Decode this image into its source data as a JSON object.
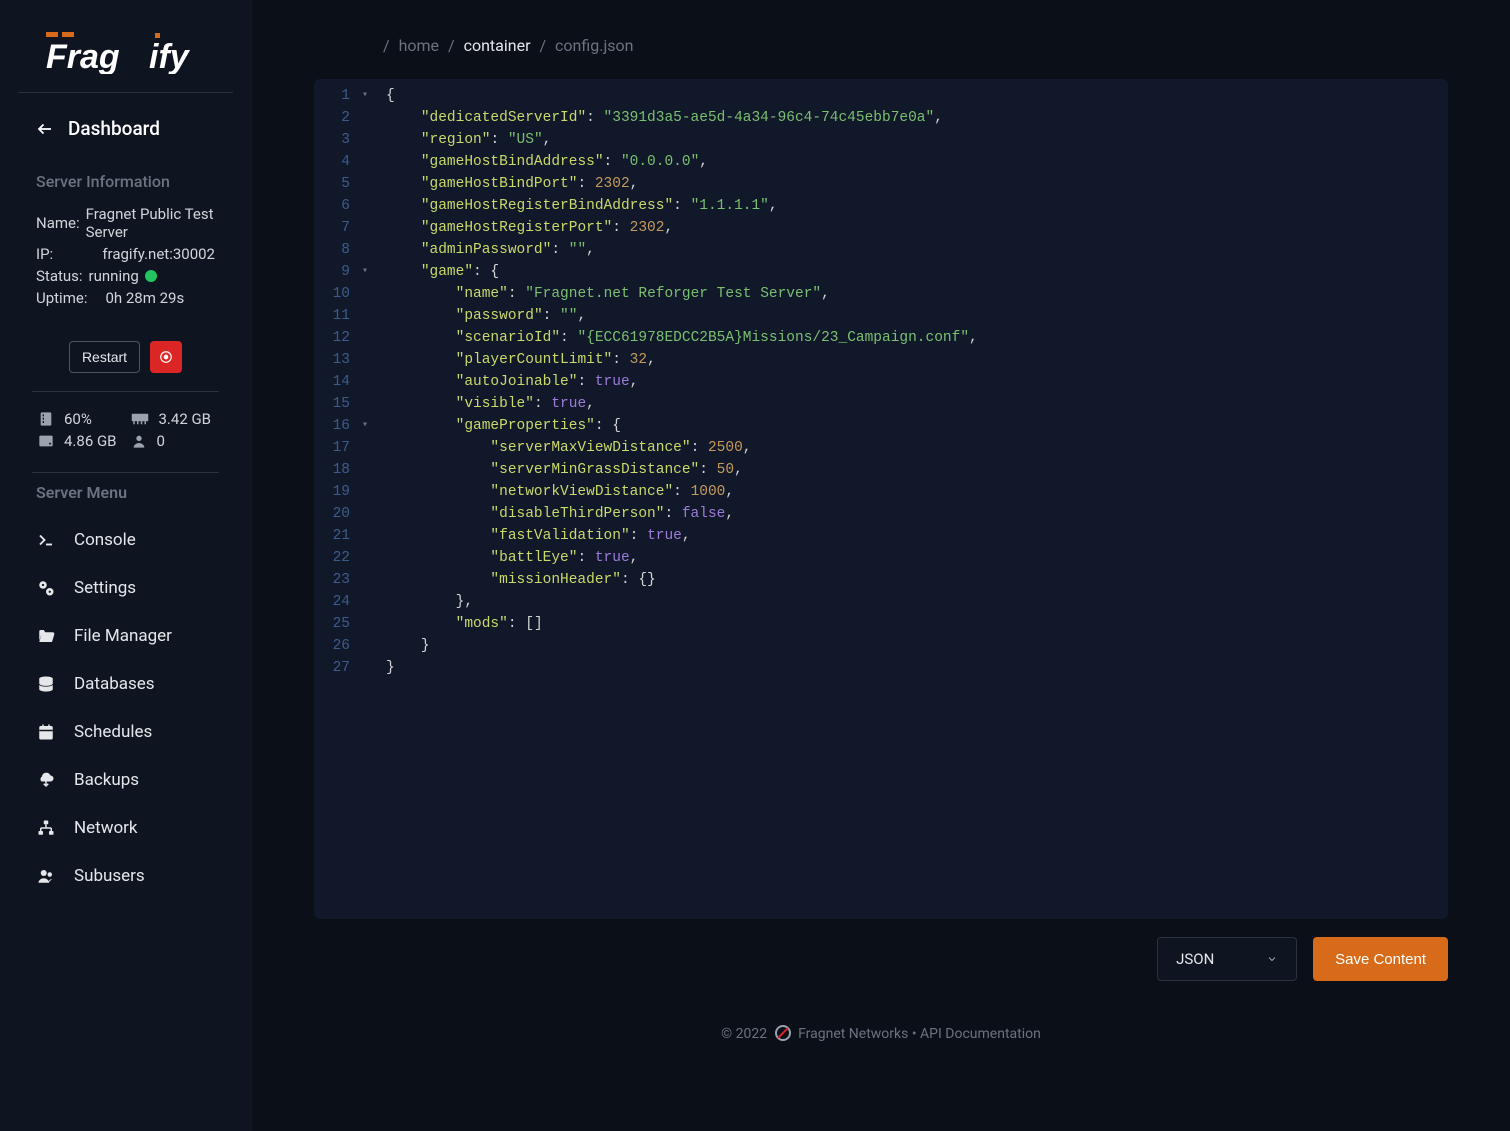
{
  "brand": "Fragify",
  "dashboard_label": "Dashboard",
  "section_info_heading": "Server Information",
  "info": {
    "name_label": "Name:",
    "name_value": "Fragnet Public Test Server",
    "ip_label": "IP:",
    "ip_value": "fragify.net:30002",
    "status_label": "Status:",
    "status_value": "running",
    "uptime_label": "Uptime:",
    "uptime_value": "0h 28m 29s"
  },
  "buttons": {
    "restart": "Restart",
    "save_content": "Save Content"
  },
  "stats": {
    "cpu_pct": "60%",
    "ram": "3.42 GB",
    "disk": "4.86 GB",
    "users": "0"
  },
  "menu_heading": "Server Menu",
  "menu": {
    "console": "Console",
    "settings": "Settings",
    "file_manager": "File Manager",
    "databases": "Databases",
    "schedules": "Schedules",
    "backups": "Backups",
    "network": "Network",
    "subusers": "Subusers"
  },
  "breadcrumb": {
    "home": "home",
    "container": "container",
    "file": "config.json"
  },
  "format_select": "JSON",
  "footer": {
    "copyright": "© 2022",
    "company": "Fragnet Networks",
    "docs": "API Documentation"
  },
  "code_lines": [
    {
      "n": 1,
      "fold": "▾",
      "indent": 0,
      "tokens": [
        {
          "t": "punc",
          "v": "{"
        }
      ]
    },
    {
      "n": 2,
      "indent": 1,
      "tokens": [
        {
          "t": "key",
          "v": "\"dedicatedServerId\""
        },
        {
          "t": "punc",
          "v": ": "
        },
        {
          "t": "str",
          "v": "\"3391d3a5-ae5d-4a34-96c4-74c45ebb7e0a\""
        },
        {
          "t": "punc",
          "v": ","
        }
      ]
    },
    {
      "n": 3,
      "indent": 1,
      "tokens": [
        {
          "t": "key",
          "v": "\"region\""
        },
        {
          "t": "punc",
          "v": ": "
        },
        {
          "t": "str",
          "v": "\"US\""
        },
        {
          "t": "punc",
          "v": ","
        }
      ]
    },
    {
      "n": 4,
      "indent": 1,
      "tokens": [
        {
          "t": "key",
          "v": "\"gameHostBindAddress\""
        },
        {
          "t": "punc",
          "v": ": "
        },
        {
          "t": "str",
          "v": "\"0.0.0.0\""
        },
        {
          "t": "punc",
          "v": ","
        }
      ]
    },
    {
      "n": 5,
      "indent": 1,
      "tokens": [
        {
          "t": "key",
          "v": "\"gameHostBindPort\""
        },
        {
          "t": "punc",
          "v": ": "
        },
        {
          "t": "num",
          "v": "2302"
        },
        {
          "t": "punc",
          "v": ","
        }
      ]
    },
    {
      "n": 6,
      "indent": 1,
      "tokens": [
        {
          "t": "key",
          "v": "\"gameHostRegisterBindAddress\""
        },
        {
          "t": "punc",
          "v": ": "
        },
        {
          "t": "str",
          "v": "\"1.1.1.1\""
        },
        {
          "t": "punc",
          "v": ","
        }
      ]
    },
    {
      "n": 7,
      "indent": 1,
      "tokens": [
        {
          "t": "key",
          "v": "\"gameHostRegisterPort\""
        },
        {
          "t": "punc",
          "v": ": "
        },
        {
          "t": "num",
          "v": "2302"
        },
        {
          "t": "punc",
          "v": ","
        }
      ]
    },
    {
      "n": 8,
      "indent": 1,
      "tokens": [
        {
          "t": "key",
          "v": "\"adminPassword\""
        },
        {
          "t": "punc",
          "v": ": "
        },
        {
          "t": "str",
          "v": "\"\""
        },
        {
          "t": "punc",
          "v": ","
        }
      ]
    },
    {
      "n": 9,
      "fold": "▾",
      "indent": 1,
      "tokens": [
        {
          "t": "key",
          "v": "\"game\""
        },
        {
          "t": "punc",
          "v": ": {"
        }
      ]
    },
    {
      "n": 10,
      "indent": 2,
      "tokens": [
        {
          "t": "key",
          "v": "\"name\""
        },
        {
          "t": "punc",
          "v": ": "
        },
        {
          "t": "str",
          "v": "\"Fragnet.net Reforger Test Server\""
        },
        {
          "t": "punc",
          "v": ","
        }
      ]
    },
    {
      "n": 11,
      "indent": 2,
      "tokens": [
        {
          "t": "key",
          "v": "\"password\""
        },
        {
          "t": "punc",
          "v": ": "
        },
        {
          "t": "str",
          "v": "\"\""
        },
        {
          "t": "punc",
          "v": ","
        }
      ]
    },
    {
      "n": 12,
      "indent": 2,
      "tokens": [
        {
          "t": "key",
          "v": "\"scenarioId\""
        },
        {
          "t": "punc",
          "v": ": "
        },
        {
          "t": "str",
          "v": "\"{ECC61978EDCC2B5A}Missions/23_Campaign.conf\""
        },
        {
          "t": "punc",
          "v": ","
        }
      ]
    },
    {
      "n": 13,
      "indent": 2,
      "tokens": [
        {
          "t": "key",
          "v": "\"playerCountLimit\""
        },
        {
          "t": "punc",
          "v": ": "
        },
        {
          "t": "num",
          "v": "32"
        },
        {
          "t": "punc",
          "v": ","
        }
      ]
    },
    {
      "n": 14,
      "indent": 2,
      "tokens": [
        {
          "t": "key",
          "v": "\"autoJoinable\""
        },
        {
          "t": "punc",
          "v": ": "
        },
        {
          "t": "bool",
          "v": "true"
        },
        {
          "t": "punc",
          "v": ","
        }
      ]
    },
    {
      "n": 15,
      "indent": 2,
      "tokens": [
        {
          "t": "key",
          "v": "\"visible\""
        },
        {
          "t": "punc",
          "v": ": "
        },
        {
          "t": "bool",
          "v": "true"
        },
        {
          "t": "punc",
          "v": ","
        }
      ]
    },
    {
      "n": 16,
      "fold": "▾",
      "indent": 2,
      "tokens": [
        {
          "t": "key",
          "v": "\"gameProperties\""
        },
        {
          "t": "punc",
          "v": ": {"
        }
      ]
    },
    {
      "n": 17,
      "indent": 3,
      "tokens": [
        {
          "t": "key",
          "v": "\"serverMaxViewDistance\""
        },
        {
          "t": "punc",
          "v": ": "
        },
        {
          "t": "num",
          "v": "2500"
        },
        {
          "t": "punc",
          "v": ","
        }
      ]
    },
    {
      "n": 18,
      "indent": 3,
      "tokens": [
        {
          "t": "key",
          "v": "\"serverMinGrassDistance\""
        },
        {
          "t": "punc",
          "v": ": "
        },
        {
          "t": "num",
          "v": "50"
        },
        {
          "t": "punc",
          "v": ","
        }
      ]
    },
    {
      "n": 19,
      "indent": 3,
      "tokens": [
        {
          "t": "key",
          "v": "\"networkViewDistance\""
        },
        {
          "t": "punc",
          "v": ": "
        },
        {
          "t": "num",
          "v": "1000"
        },
        {
          "t": "punc",
          "v": ","
        }
      ]
    },
    {
      "n": 20,
      "indent": 3,
      "tokens": [
        {
          "t": "key",
          "v": "\"disableThirdPerson\""
        },
        {
          "t": "punc",
          "v": ": "
        },
        {
          "t": "bool",
          "v": "false"
        },
        {
          "t": "punc",
          "v": ","
        }
      ]
    },
    {
      "n": 21,
      "indent": 3,
      "tokens": [
        {
          "t": "key",
          "v": "\"fastValidation\""
        },
        {
          "t": "punc",
          "v": ": "
        },
        {
          "t": "bool",
          "v": "true"
        },
        {
          "t": "punc",
          "v": ","
        }
      ]
    },
    {
      "n": 22,
      "indent": 3,
      "tokens": [
        {
          "t": "key",
          "v": "\"battlEye\""
        },
        {
          "t": "punc",
          "v": ": "
        },
        {
          "t": "bool",
          "v": "true"
        },
        {
          "t": "punc",
          "v": ","
        }
      ]
    },
    {
      "n": 23,
      "indent": 3,
      "tokens": [
        {
          "t": "key",
          "v": "\"missionHeader\""
        },
        {
          "t": "punc",
          "v": ": {}"
        }
      ]
    },
    {
      "n": 24,
      "indent": 2,
      "tokens": [
        {
          "t": "punc",
          "v": "},"
        }
      ]
    },
    {
      "n": 25,
      "indent": 2,
      "tokens": [
        {
          "t": "key",
          "v": "\"mods\""
        },
        {
          "t": "punc",
          "v": ": []"
        }
      ]
    },
    {
      "n": 26,
      "indent": 1,
      "tokens": [
        {
          "t": "punc",
          "v": "}"
        }
      ]
    },
    {
      "n": 27,
      "indent": 0,
      "tokens": [
        {
          "t": "punc",
          "v": "}"
        }
      ]
    }
  ]
}
